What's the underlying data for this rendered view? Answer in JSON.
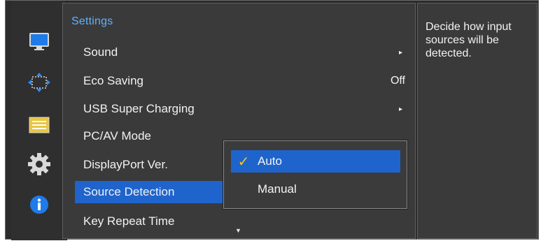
{
  "sidebar": {
    "icons": [
      {
        "name": "picture-icon"
      },
      {
        "name": "onscreen-display-icon"
      },
      {
        "name": "settings-list-icon"
      },
      {
        "name": "system-gear-icon"
      },
      {
        "name": "information-icon"
      }
    ]
  },
  "menu": {
    "title": "Settings",
    "items": [
      {
        "label": "Sound",
        "value": "",
        "arrow": "▸"
      },
      {
        "label": "Eco Saving",
        "value": "Off",
        "arrow": ""
      },
      {
        "label": "USB Super Charging",
        "value": "",
        "arrow": "▸"
      },
      {
        "label": "PC/AV Mode",
        "value": "",
        "arrow": ""
      },
      {
        "label": "DisplayPort Ver.",
        "value": "",
        "arrow": ""
      },
      {
        "label": "Source Detection",
        "value": "",
        "arrow": "",
        "selected": true
      },
      {
        "label": "Key Repeat Time",
        "value": "",
        "arrow": ""
      }
    ],
    "scroll_down": "▼"
  },
  "submenu": {
    "items": [
      {
        "label": "Auto",
        "checked": true
      },
      {
        "label": "Manual",
        "checked": false
      }
    ],
    "check_glyph": "✓"
  },
  "help": {
    "text": "Decide how input sources will be detected."
  },
  "colors": {
    "accent_blue": "#1f64cc",
    "title_blue": "#5fb0ff",
    "check_yellow": "#f5c518"
  }
}
